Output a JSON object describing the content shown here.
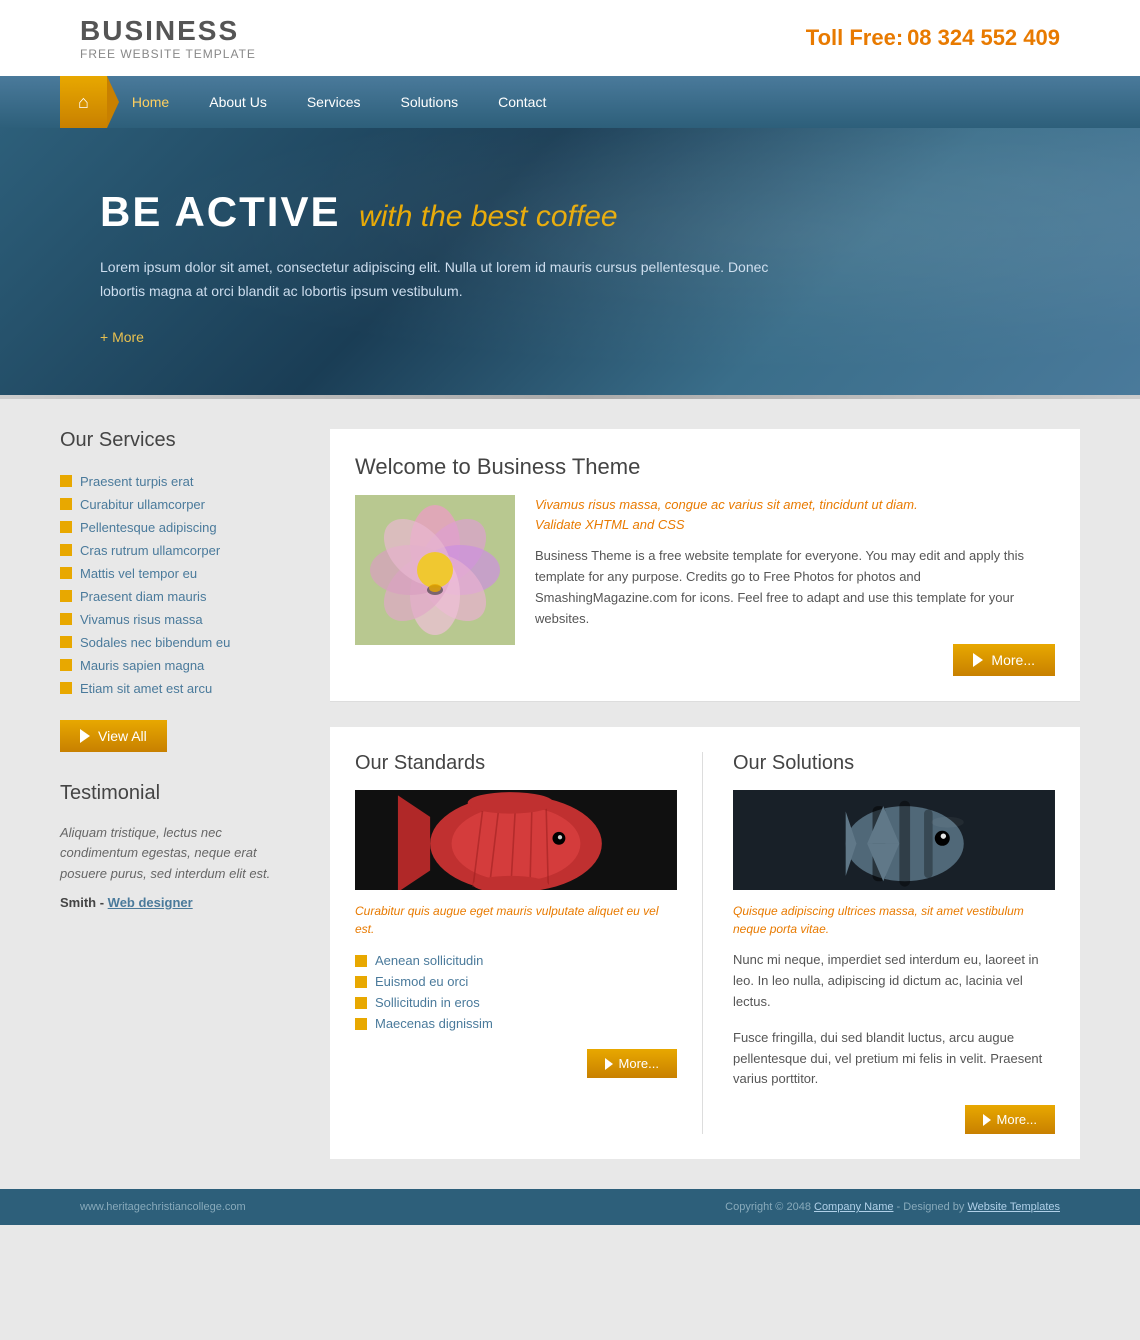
{
  "logo": {
    "title": "BUSINESS",
    "subtitle": "FREE WEBSITE TEMPLATE"
  },
  "contact": {
    "label": "Toll Free:",
    "phone": "08 324 552 409"
  },
  "nav": {
    "home": "Home",
    "about": "About Us",
    "services": "Services",
    "solutions": "Solutions",
    "contact": "Contact"
  },
  "hero": {
    "title_white": "BE ACTIVE",
    "title_yellow": "with the best coffee",
    "body": "Lorem ipsum dolor sit amet, consectetur adipiscing elit. Nulla ut lorem id mauris cursus pellentesque. Donec lobortis magna at orci blandit ac lobortis ipsum vestibulum.",
    "more": "+ More"
  },
  "sidebar": {
    "services_title": "Our Services",
    "services_items": [
      "Praesent turpis erat",
      "Curabitur ullamcorper",
      "Pellentesque adipiscing",
      "Cras rutrum ullamcorper",
      "Mattis vel tempor eu",
      "Praesent diam mauris",
      "Vivamus risus massa",
      "Sodales nec bibendum eu",
      "Mauris sapien magna",
      "Etiam sit amet est arcu"
    ],
    "view_all": "View All",
    "testimonial_title": "Testimonial",
    "testimonial_text": "Aliquam tristique, lectus nec condimentum egestas, neque erat posuere purus, sed interdum elit est.",
    "testimonial_author": "Smith - ",
    "testimonial_role": "Web designer"
  },
  "welcome": {
    "title": "Welcome to Business Theme",
    "italic1": "Vivamus risus massa, congue ac varius sit amet, tincidunt ut diam.",
    "italic2": "Validate XHTML and CSS",
    "body": "Business Theme is a free website template for everyone. You may edit and apply this template for any purpose. Credits go to Free Photos for photos and SmashingMagazine.com for icons. Feel free to adapt and use this template for your websites.",
    "more": "More..."
  },
  "standards": {
    "title": "Our Standards",
    "italic": "Curabitur quis augue eget mauris vulputate aliquet eu vel est.",
    "items": [
      "Aenean sollicitudin",
      "Euismod eu orci",
      "Sollicitudin in eros",
      "Maecenas dignissim"
    ],
    "more": "More..."
  },
  "solutions": {
    "title": "Our Solutions",
    "italic": "Quisque adipiscing ultrices massa, sit amet vestibulum neque porta vitae.",
    "body1": "Nunc mi neque, imperdiet sed interdum eu, laoreet in leo. In leo nulla, adipiscing id dictum ac, lacinia vel lectus.",
    "body2": "Fusce fringilla, dui sed blandit luctus, arcu augue pellentesque dui, vel pretium mi felis in velit. Praesent varius porttitor.",
    "more": "More..."
  },
  "footer": {
    "left": "www.heritagechristiancollege.com",
    "copyright": "Copyright © 2048 ",
    "company": "Company Name",
    "designed": " - Designed by ",
    "templates": "Website Templates"
  }
}
